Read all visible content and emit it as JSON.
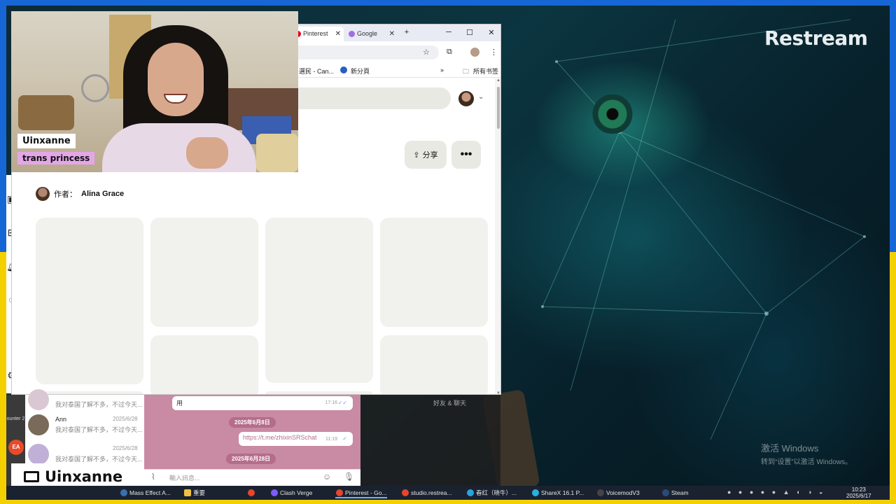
{
  "overlay": {
    "brand": "Restream",
    "streamer_name": "Uinxanne",
    "streamer_tag": "trans princess",
    "channel_badge_name": "Uinxanne",
    "activate_windows_title": "激活 Windows",
    "activate_windows_sub": "转到“设置”以激活 Windows。"
  },
  "browser": {
    "tabs": [
      {
        "label": "Pinterest",
        "active": true,
        "color": "#e60023"
      },
      {
        "label": "Google",
        "active": false,
        "color": "#a46de0"
      }
    ],
    "new_tab_icon": "plus-icon",
    "window_controls": [
      "minimize-icon",
      "maximize-icon",
      "close-icon"
    ],
    "bookmarks": [
      {
        "label": "選民 - Can..."
      },
      {
        "label": "新分頁"
      }
    ],
    "all_bookmarks": "所有书签",
    "share_label": "分享",
    "more_label": "•••",
    "author_prefix": "作者：",
    "author_name": "Alina Grace"
  },
  "chat": {
    "items": [
      {
        "name": "",
        "date": "",
        "message": "我对泰国了解不多，不过今天..."
      },
      {
        "name": "Ann",
        "date": "2025/6/28",
        "message": "我对泰国了解不多，不过今天..."
      },
      {
        "name": "",
        "date": "2025/6/28",
        "message": "我对泰国了解不多，不过今天..."
      }
    ],
    "messages": [
      {
        "text": "用",
        "time": "17:16"
      },
      {
        "text": "https://t.me/zhixinSRSchat",
        "time": "11:19"
      }
    ],
    "dates": [
      "2025年6月8日",
      "2025年6月28日"
    ],
    "input_placeholder": "輸入訊息...",
    "right_label": "好友 & 聊天",
    "side_text": "ounter 2"
  },
  "taskbar": {
    "items": [
      {
        "label": "Mass Effect A...",
        "color": "#3a6fb0"
      },
      {
        "label": "重要",
        "color": "#f0c040"
      },
      {
        "label": "",
        "color": "#e8452c"
      },
      {
        "label": "Clash Verge",
        "color": "#7c5cff"
      },
      {
        "label": "Pinterest - Go...",
        "color": "#e8452c"
      },
      {
        "label": "studio.restrea...",
        "color": "#e8452c"
      },
      {
        "label": "春红（晓牛）...",
        "color": "#2aa3e0"
      },
      {
        "label": "ShareX 16.1 P...",
        "color": "#2ab0e0"
      },
      {
        "label": "VoicemodV3",
        "color": "#222222"
      },
      {
        "label": "Steam",
        "color": "#2a4a7a"
      }
    ],
    "time": "10:23",
    "date": "2025/6/17"
  }
}
